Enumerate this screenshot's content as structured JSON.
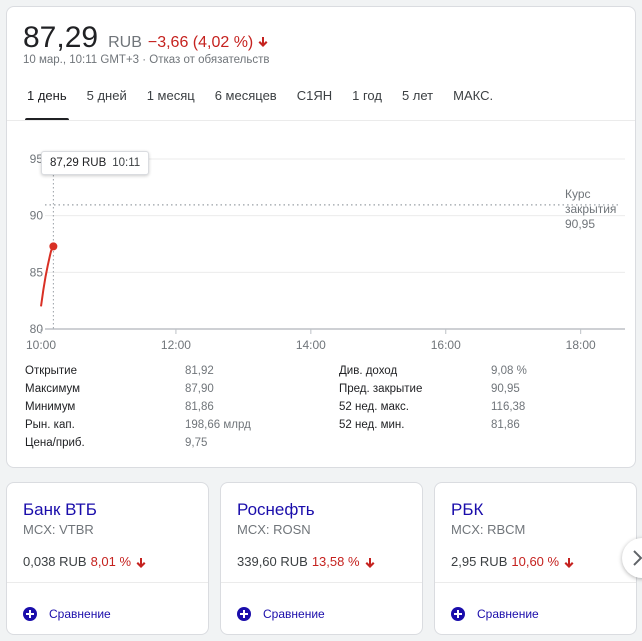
{
  "header": {
    "price": "87,29",
    "currency": "RUB",
    "change": "−3,66 (4,02 %)",
    "sub": "10 мар., 10:11 GMT+3 · Отказ от обязательств"
  },
  "tabs": [
    {
      "label": "1 день",
      "active": true
    },
    {
      "label": "5 дней",
      "active": false
    },
    {
      "label": "1 месяц",
      "active": false
    },
    {
      "label": "6 месяцев",
      "active": false
    },
    {
      "label": "С1ЯН",
      "active": false
    },
    {
      "label": "1 год",
      "active": false
    },
    {
      "label": "5 лет",
      "active": false
    },
    {
      "label": "МАКС.",
      "active": false
    }
  ],
  "tooltip": {
    "price": "87,29 RUB",
    "time": "10:11"
  },
  "close_label": {
    "line1": "Курс",
    "line2": "закрытия",
    "line3": "90,95"
  },
  "chart_data": {
    "type": "line",
    "x": [
      "10:00",
      "10:02",
      "10:04",
      "10:06",
      "10:08",
      "10:09",
      "10:11"
    ],
    "values": [
      82.0,
      83.4,
      84.6,
      85.6,
      86.5,
      86.9,
      87.29
    ],
    "ylim": [
      80,
      95
    ],
    "yticks": [
      "95",
      "90",
      "85",
      "80"
    ],
    "xticks": [
      "10:00",
      "12:00",
      "14:00",
      "16:00",
      "18:00"
    ],
    "xrange_hours": [
      10,
      19.25
    ],
    "previous_close": 90.95,
    "colors": {
      "line": "#d93025",
      "grid": "#ebebeb",
      "axis": "#dadce0"
    }
  },
  "stats": {
    "left": [
      {
        "label": "Открытие",
        "value": "81,92"
      },
      {
        "label": "Максимум",
        "value": "87,90"
      },
      {
        "label": "Минимум",
        "value": "81,86"
      },
      {
        "label": "Рын. кап.",
        "value": "198,66 млрд"
      },
      {
        "label": "Цена/приб.",
        "value": "9,75"
      }
    ],
    "right": [
      {
        "label": "Див. доход",
        "value": "9,08 %"
      },
      {
        "label": "Пред. закрытие",
        "value": "90,95"
      },
      {
        "label": "52 нед. макс.",
        "value": "116,38"
      },
      {
        "label": "52 нед. мин.",
        "value": "81,86"
      }
    ]
  },
  "related": [
    {
      "name": "Банк ВТБ",
      "ticker": "MCX: VTBR",
      "price": "0,038 RUB",
      "change": "8,01 %",
      "compare": "Сравнение"
    },
    {
      "name": "Роснефть",
      "ticker": "MCX: ROSN",
      "price": "339,60 RUB",
      "change": "13,58 %",
      "compare": "Сравнение"
    },
    {
      "name": "РБК",
      "ticker": "MCX: RBCM",
      "price": "2,95 RUB",
      "change": "10,60 %",
      "compare": "Сравнение"
    }
  ],
  "icons": {
    "down_arrow": "arrow-down-icon",
    "plus": "plus-circle-icon",
    "next": "chevron-right-icon"
  }
}
